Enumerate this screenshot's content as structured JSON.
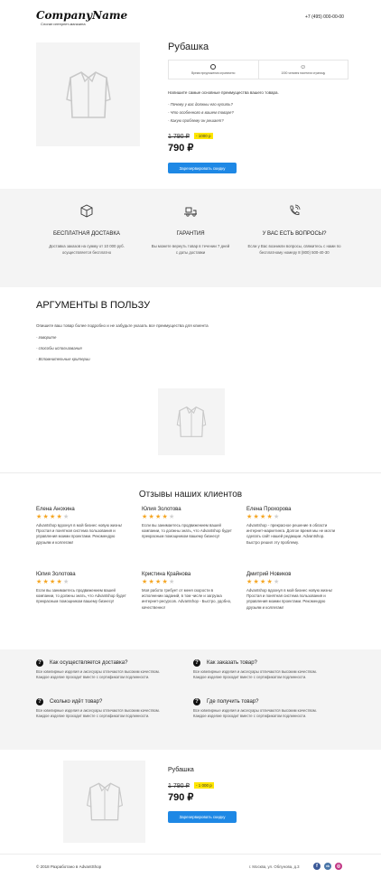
{
  "header": {
    "logo": "CompanyName",
    "tagline": "Слоган интернет-магазина",
    "phone": "+7 (495) 000-00-00"
  },
  "product": {
    "title": "Рубашка",
    "features": [
      {
        "icon": "clock-icon",
        "text": "Время предложения ограничено"
      },
      {
        "icon": "smile-icon",
        "text": "1000 человек посетили страницу"
      }
    ],
    "intro": "Напишите самые основные преимущества вашего товара.",
    "questions": [
      "- Почему у вас должны его купить?",
      "- Что особенного в вашем товаре?",
      "- Какую проблему он решает?"
    ],
    "old_price": "1 790 ₽",
    "discount": "- 1000 р",
    "price": "790 ₽",
    "button": "Зарезервировать скидку"
  },
  "benefits": [
    {
      "icon": "box-icon",
      "title": "БЕСПЛАТНАЯ ДОСТАВКА",
      "text": "Доставка заказов на сумму от 10 000 руб. осуществляется бесплатно"
    },
    {
      "icon": "delivery-icon",
      "title": "ГАРАНТИЯ",
      "text": "Вы можете вернуть товар в течении 7 дней с даты доставки"
    },
    {
      "icon": "phone-icon",
      "title": "У ВАС ЕСТЬ ВОПРОСЫ?",
      "text": "Если у Вас возникли вопросы, свяжитесь с нами по бесплатному номеру 8 (800) 500-40-30"
    }
  ],
  "arguments": {
    "title": "АРГУМЕНТЫ В ПОЛЬЗУ",
    "intro": "Опишите ваш товар более подробно и не забудьте указать все преимущества для клиента",
    "items": [
      "- говорите",
      "- способы использования",
      "- Вспомнительные критерии"
    ]
  },
  "reviews": {
    "title": "Отзывы наших клиентов",
    "items": [
      {
        "name": "Елена Анохина",
        "rating": 4,
        "text": "Advantshop вдохнул в мой бизнес новую жизнь! Простая и понятная система пользования и управления моими проектами. Рекомендую друзьям и коллегам!"
      },
      {
        "name": "Юлия Золотова",
        "rating": 4,
        "text": "Если вы занимаетесь продвижением вашей компании, то должны знать, что Advantshop будет прекрасным помощником вашему бизнесу!"
      },
      {
        "name": "Елена Прохорова",
        "rating": 4,
        "text": "Advantshop - прекрасное решение в области интернет-маркетинга. Долгое время мы не могли сделать сайт нашей редакции. Advantshop. Быстро решил эту проблему."
      },
      {
        "name": "Юлия Золотова",
        "rating": 4,
        "text": "Если вы занимаетесь продвижением вашей компании, то должны знать, что Advantshop будет прекрасным помощником вашему бизнесу!"
      },
      {
        "name": "Кристина Крайнова",
        "rating": 4,
        "text": "Моя работа требует от меня скорости в исполнении заданий, в том числе и загрузка интернет-ресурсов. Advantshop - Быстро, удобно, качественно!"
      },
      {
        "name": "Дмитрий Новиков",
        "rating": 4,
        "text": "Advantshop вдохнул в мой бизнес новую жизнь! Простая и понятная система пользования и управления моими проектами. Рекомендую друзьям и коллегам!"
      }
    ]
  },
  "faq": [
    {
      "q": "Как осуществляется доставка?",
      "a": "Все ювелирные изделия и аксесуары отличаются высоким качеством. Каждое изделие проходит вместе с сертификатом подлинности."
    },
    {
      "q": "Как заказать товар?",
      "a": "Все ювелирные изделия и аксесуары отличаются высоким качеством. Каждое изделие проходит вместе с сертификатом подлинности."
    },
    {
      "q": "Сколько идёт товар?",
      "a": "Все ювелирные изделия и аксесуары отличаются высоким качеством. Каждое изделие проходит вместе с сертификатом подлинности."
    },
    {
      "q": "Где получить товар?",
      "a": "Все ювелирные изделия и аксесуары отличаются высоким качеством. Каждое изделие проходит вместе с сертификатом подлинности."
    }
  ],
  "bottom_product": {
    "title": "Рубашка",
    "old_price": "1 790 ₽",
    "discount": "- 1 000 р",
    "price": "790 ₽",
    "button": "Зарезервировать скидку"
  },
  "footer": {
    "copyright": "© 2018 Разработано в AdvantShop",
    "address": "г. Москва, ул. Облунова, д.3",
    "social": [
      {
        "icon": "facebook-icon",
        "glyph": "f",
        "color": "#3b5998"
      },
      {
        "icon": "vk-icon",
        "glyph": "vk",
        "color": "#4a76a8"
      },
      {
        "icon": "instagram-icon",
        "glyph": "◎",
        "color": "#c13584"
      }
    ]
  }
}
